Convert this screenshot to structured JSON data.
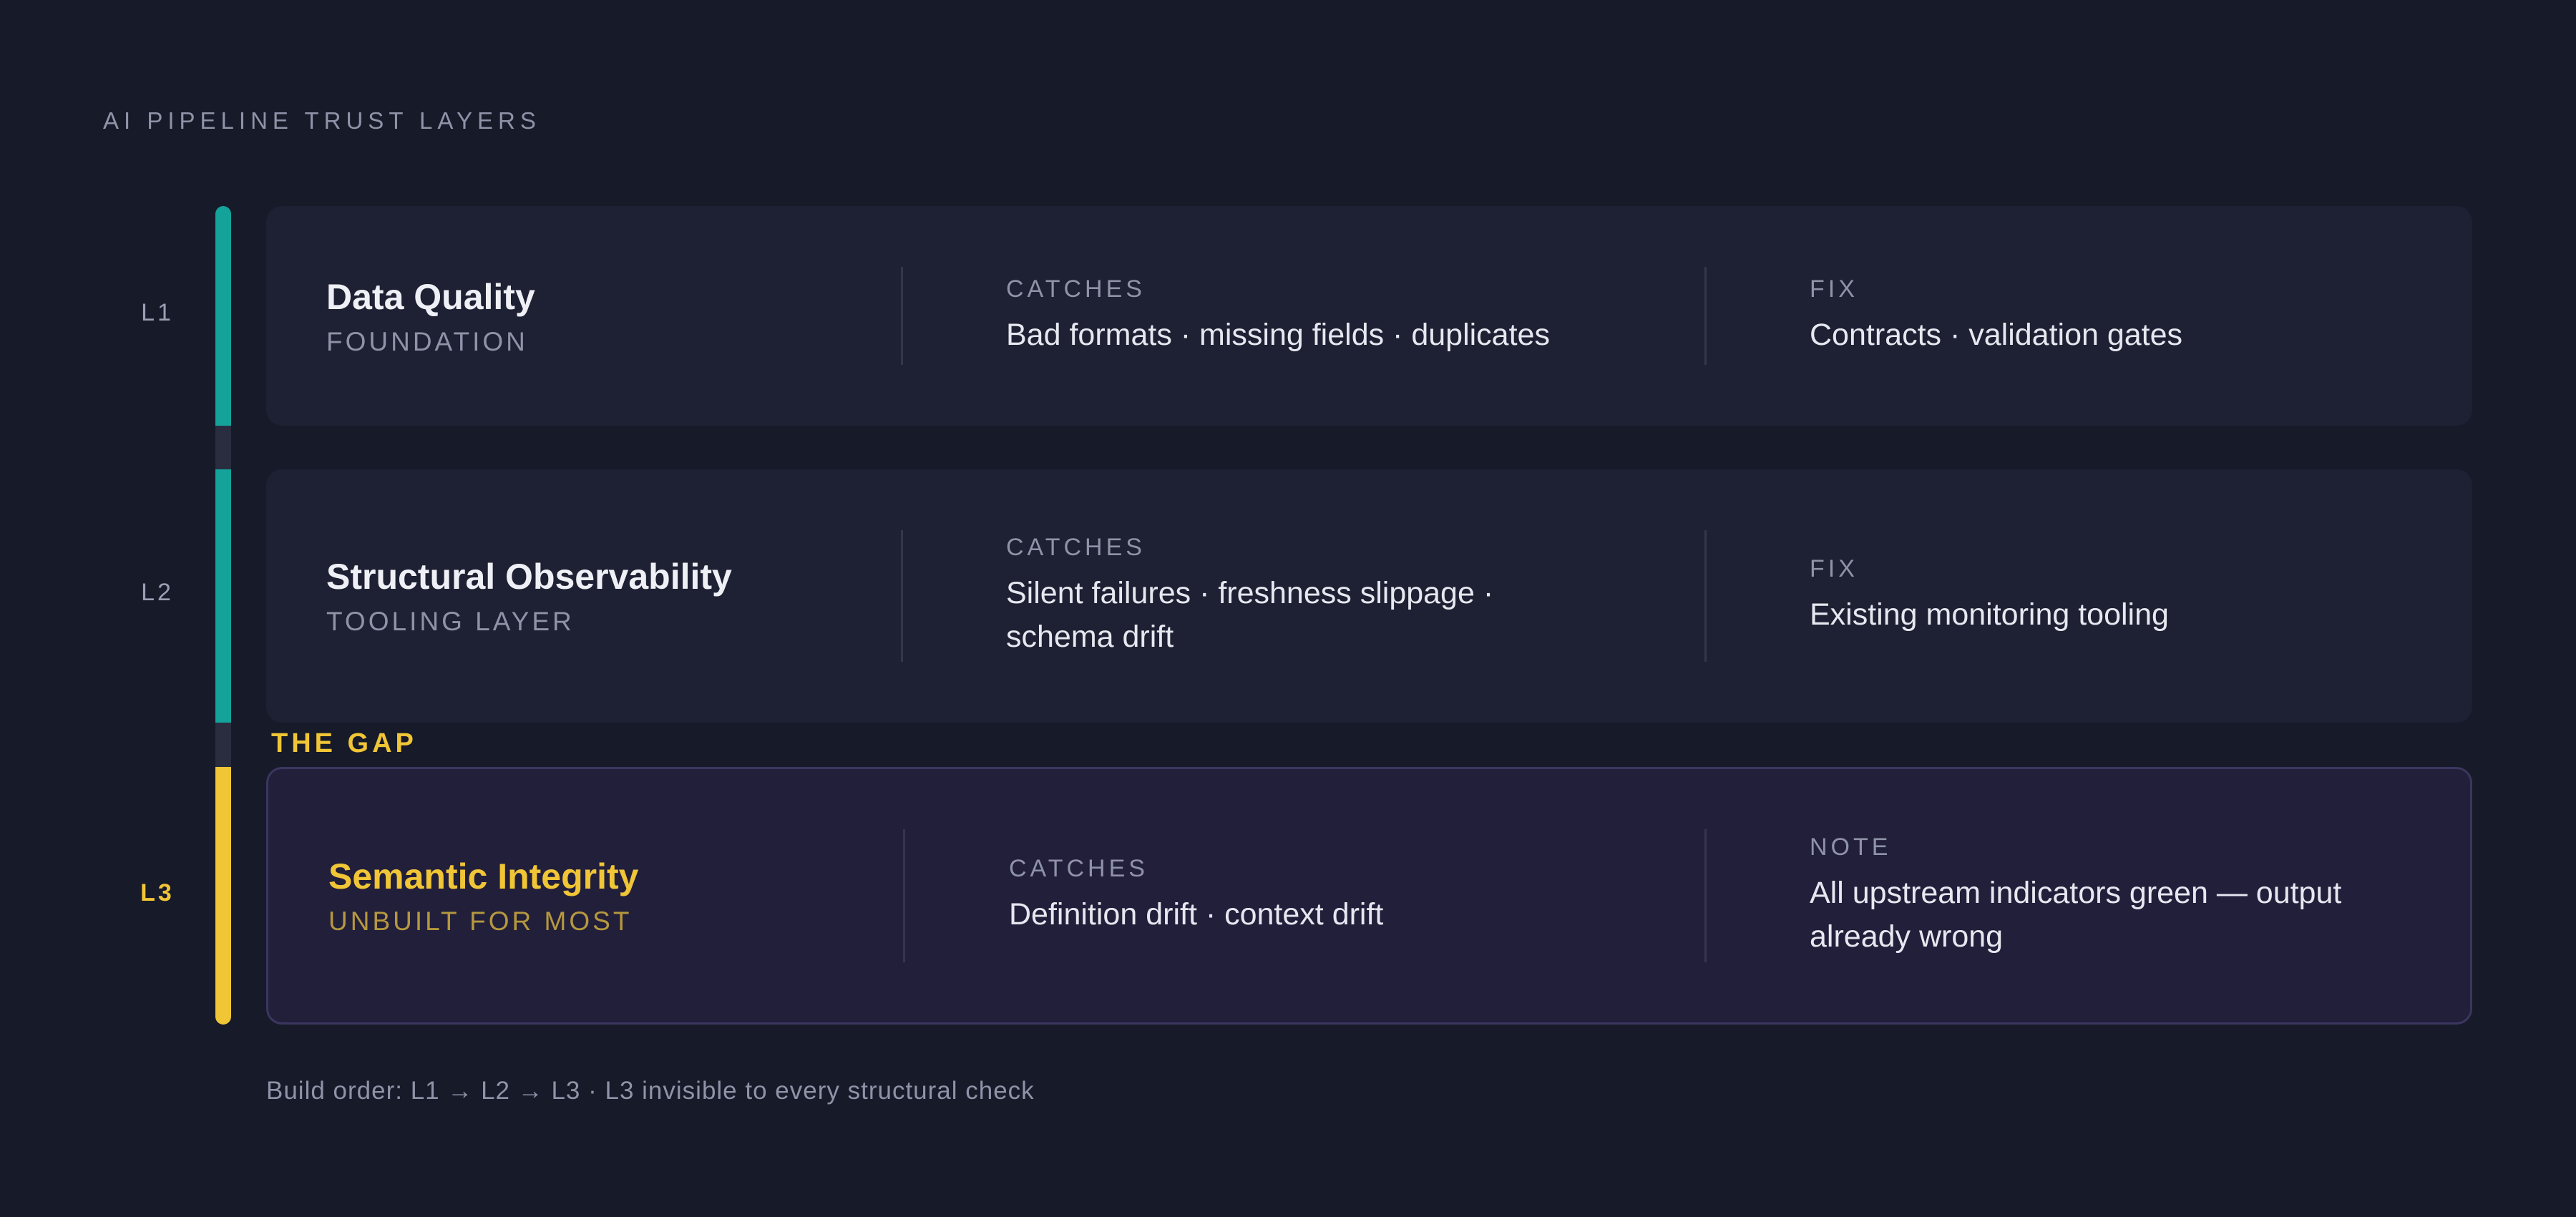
{
  "header": {
    "title": "AI PIPELINE TRUST LAYERS"
  },
  "colors": {
    "background": "#171a28",
    "teal": "#14a39a",
    "gold": "#f0c536",
    "card": "#1e2033",
    "card_highlight": "#221f3b"
  },
  "layers": [
    {
      "level": "L1",
      "name": "Data Quality",
      "subtitle": "FOUNDATION",
      "catches_label": "CATCHES",
      "catches": "Bad formats · missing fields · duplicates",
      "fix_label": "FIX",
      "fix": "Contracts · validation gates"
    },
    {
      "level": "L2",
      "name": "Structural Observability",
      "subtitle": "TOOLING LAYER",
      "catches_label": "CATCHES",
      "catches": "Silent failures · freshness slippage · schema drift",
      "fix_label": "FIX",
      "fix": "Existing monitoring tooling"
    },
    {
      "level": "L3",
      "name": "Semantic Integrity",
      "subtitle": "UNBUILT FOR MOST",
      "catches_label": "CATCHES",
      "catches": "Definition drift · context drift",
      "fix_label": "NOTE",
      "fix": "All upstream indicators green — output already wrong"
    }
  ],
  "gap_label": "THE GAP",
  "footer": {
    "note": "Build order: L1 → L2 → L3 · L3 invisible to every structural check"
  }
}
